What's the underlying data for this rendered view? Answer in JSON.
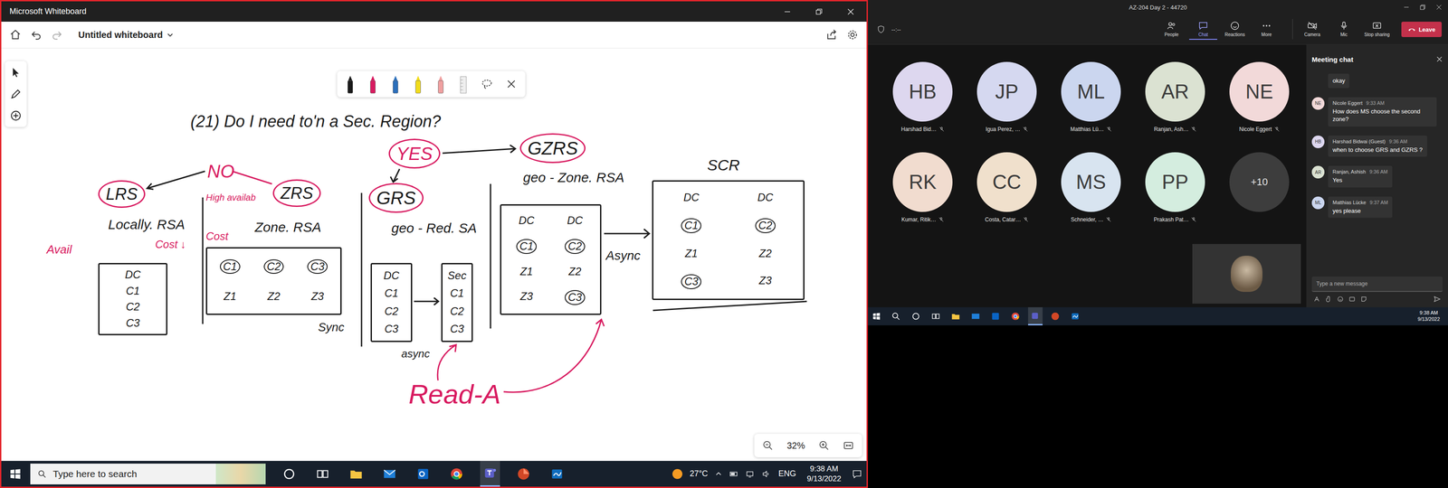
{
  "whiteboard": {
    "window": {
      "title": "Microsoft Whiteboard"
    },
    "toolbar": {
      "board_title": "Untitled whiteboard"
    },
    "pens": [
      {
        "color": "#1a1a1a"
      },
      {
        "color": "#d81b60"
      },
      {
        "color": "#2c6fbb"
      },
      {
        "color": "#f2dc1b"
      },
      {
        "color": "#f0a0a0"
      }
    ],
    "canvas": {
      "notes": [
        {
          "text": "(21) Do I need to'n a Sec. Region?",
          "color": "#1a1a1a",
          "circled": false
        },
        {
          "text": "YES",
          "color": "#d81b60",
          "circled": true
        },
        {
          "text": "GZRS",
          "color": "#1a1a1a",
          "circled": true
        },
        {
          "text": "geo - Zone. RSA",
          "color": "#1a1a1a",
          "circled": false
        },
        {
          "text": "NO",
          "color": "#d81b60",
          "circled": false
        },
        {
          "text": "LRS",
          "color": "#1a1a1a",
          "circled": true
        },
        {
          "text": "ZRS",
          "color": "#1a1a1a",
          "circled": true
        },
        {
          "text": "GRS",
          "color": "#1a1a1a",
          "circled": true
        },
        {
          "text": "geo - Red. SA",
          "color": "#1a1a1a",
          "circled": false
        },
        {
          "text": "Locally. RSA",
          "color": "#1a1a1a",
          "circled": false
        },
        {
          "text": "Zone. RSA",
          "color": "#1a1a1a",
          "circled": false
        },
        {
          "text": "High availab",
          "color": "#d81b60",
          "circled": false
        },
        {
          "text": "Cost",
          "color": "#d81b60",
          "circled": false
        },
        {
          "text": "Cost ↓",
          "color": "#d81b60",
          "circled": false
        },
        {
          "text": "Avail",
          "color": "#d81b60",
          "circled": false
        },
        {
          "text": "SCR",
          "color": "#1a1a1a",
          "circled": false
        },
        {
          "text": "Sync",
          "color": "#1a1a1a",
          "circled": false
        },
        {
          "text": "Async",
          "color": "#1a1a1a",
          "circled": false
        },
        {
          "text": "async",
          "color": "#1a1a1a",
          "circled": false
        },
        {
          "text": "Read-A",
          "color": "#d81b60",
          "circled": false
        }
      ],
      "boxes": [
        {
          "cells": [
            {
              "text": "DC",
              "circled": false
            },
            {
              "text": "C1",
              "circled": false
            },
            {
              "text": "C2",
              "circled": false
            },
            {
              "text": "C3",
              "circled": false
            }
          ]
        },
        {
          "cells": [
            {
              "text": "C1",
              "circled": true
            },
            {
              "text": "C2",
              "circled": true
            },
            {
              "text": "C3",
              "circled": true
            },
            {
              "text": "Z1",
              "circled": false
            },
            {
              "text": "Z2",
              "circled": false
            },
            {
              "text": "Z3",
              "circled": false
            }
          ]
        },
        {
          "cells": [
            {
              "text": "DC",
              "circled": false
            },
            {
              "text": "C1",
              "circled": false
            },
            {
              "text": "C2",
              "circled": false
            },
            {
              "text": "C3",
              "circled": false
            }
          ]
        },
        {
          "cells": [
            {
              "text": "Sec",
              "circled": false
            },
            {
              "text": "C1",
              "circled": false
            },
            {
              "text": "C2",
              "circled": false
            },
            {
              "text": "C3",
              "circled": false
            }
          ]
        },
        {
          "cells": [
            {
              "text": "DC",
              "circled": false
            },
            {
              "text": "DC",
              "circled": false
            },
            {
              "text": "C1",
              "circled": true
            },
            {
              "text": "C2",
              "circled": true
            },
            {
              "text": "Z1",
              "circled": false
            },
            {
              "text": "Z2",
              "circled": false
            },
            {
              "text": "Z3",
              "circled": false
            },
            {
              "text": "C3",
              "circled": true
            }
          ]
        },
        {
          "cells": [
            {
              "text": "DC",
              "circled": false
            },
            {
              "text": "DC",
              "circled": false
            },
            {
              "text": "C1",
              "circled": true
            },
            {
              "text": "C2",
              "circled": true
            },
            {
              "text": "Z1",
              "circled": false
            },
            {
              "text": "Z2",
              "circled": false
            },
            {
              "text": "C3",
              "circled": true
            },
            {
              "text": "Z3",
              "circled": false
            }
          ]
        }
      ]
    },
    "zoom": {
      "level_text": "32%"
    }
  },
  "taskbar_left": {
    "search_placeholder": "Type here to search",
    "weather": "27°C",
    "language": "ENG",
    "time": "9:38 AM",
    "date": "9/13/2022",
    "apps": [
      {
        "active": false
      },
      {
        "active": false
      },
      {
        "active": false
      },
      {
        "active": false
      },
      {
        "active": false
      },
      {
        "active": false
      },
      {
        "active": true
      },
      {
        "active": false
      },
      {
        "active": false
      }
    ]
  },
  "teams": {
    "window": {
      "title": "AZ-204 Day 2 - 44720"
    },
    "timer": "--:--",
    "toolbar": [
      {
        "label": "People",
        "selected": false
      },
      {
        "label": "Chat",
        "selected": true
      },
      {
        "label": "Reactions",
        "selected": false
      },
      {
        "label": "More",
        "selected": false
      },
      {
        "label": "Camera",
        "selected": false
      },
      {
        "label": "Mic",
        "selected": false
      },
      {
        "label": "Stop sharing",
        "selected": false
      }
    ],
    "leave": "Leave",
    "participants": [
      {
        "initials": "HB",
        "name": "Harshad Bid…",
        "color": "#ddd7ef",
        "muted": true
      },
      {
        "initials": "JP",
        "name": "Igua Perez, …",
        "color": "#d5d8f0",
        "muted": true
      },
      {
        "initials": "ML",
        "name": "Matthias Lü…",
        "color": "#cbd6ef",
        "muted": true
      },
      {
        "initials": "AR",
        "name": "Ranjan, Ash…",
        "color": "#dbe2d2",
        "muted": true
      },
      {
        "initials": "NE",
        "name": "Nicole Eggert",
        "color": "#f2d9d9",
        "muted": true
      },
      {
        "initials": "RK",
        "name": "Kumar, Ritik…",
        "color": "#f1dccf",
        "muted": true
      },
      {
        "initials": "CC",
        "name": "Costa, Catar…",
        "color": "#f0e0cc",
        "muted": true
      },
      {
        "initials": "MS",
        "name": "Schneider, …",
        "color": "#d8e4f0",
        "muted": true
      },
      {
        "initials": "PP",
        "name": "Prakash Pat…",
        "color": "#d4eddf",
        "muted": true
      }
    ],
    "overflow": "+10",
    "chat": {
      "title": "Meeting chat",
      "messages": [
        {
          "kind": "continuation",
          "text": "okay"
        },
        {
          "kind": "message",
          "initials": "NE",
          "name": "Nicole Eggert",
          "time": "9:33 AM",
          "text": "How does MS choose the second zone?",
          "color": "#f2d9d9"
        },
        {
          "kind": "message",
          "initials": "HB",
          "name": "Harshad Bidwai (Guest)",
          "time": "9:36 AM",
          "text": "when to choose GRS and GZRS ?",
          "color": "#ddd7ef"
        },
        {
          "kind": "message",
          "initials": "AR",
          "name": "Ranjan, Ashish",
          "time": "9:36 AM",
          "text": "Yes",
          "color": "#dbe2d2"
        },
        {
          "kind": "message",
          "initials": "ML",
          "name": "Matthias Lücke",
          "time": "9:37 AM",
          "text": "yes please",
          "color": "#cbd6ef"
        }
      ],
      "compose_placeholder": "Type a new message"
    }
  },
  "taskbar_right": {
    "time": "9:38 AM",
    "date": "9/13/2022",
    "apps": [
      {
        "active": false
      },
      {
        "active": false
      },
      {
        "active": false
      },
      {
        "active": false
      },
      {
        "active": false
      },
      {
        "active": false
      },
      {
        "active": false
      },
      {
        "active": true
      },
      {
        "active": false
      },
      {
        "active": false
      }
    ]
  }
}
